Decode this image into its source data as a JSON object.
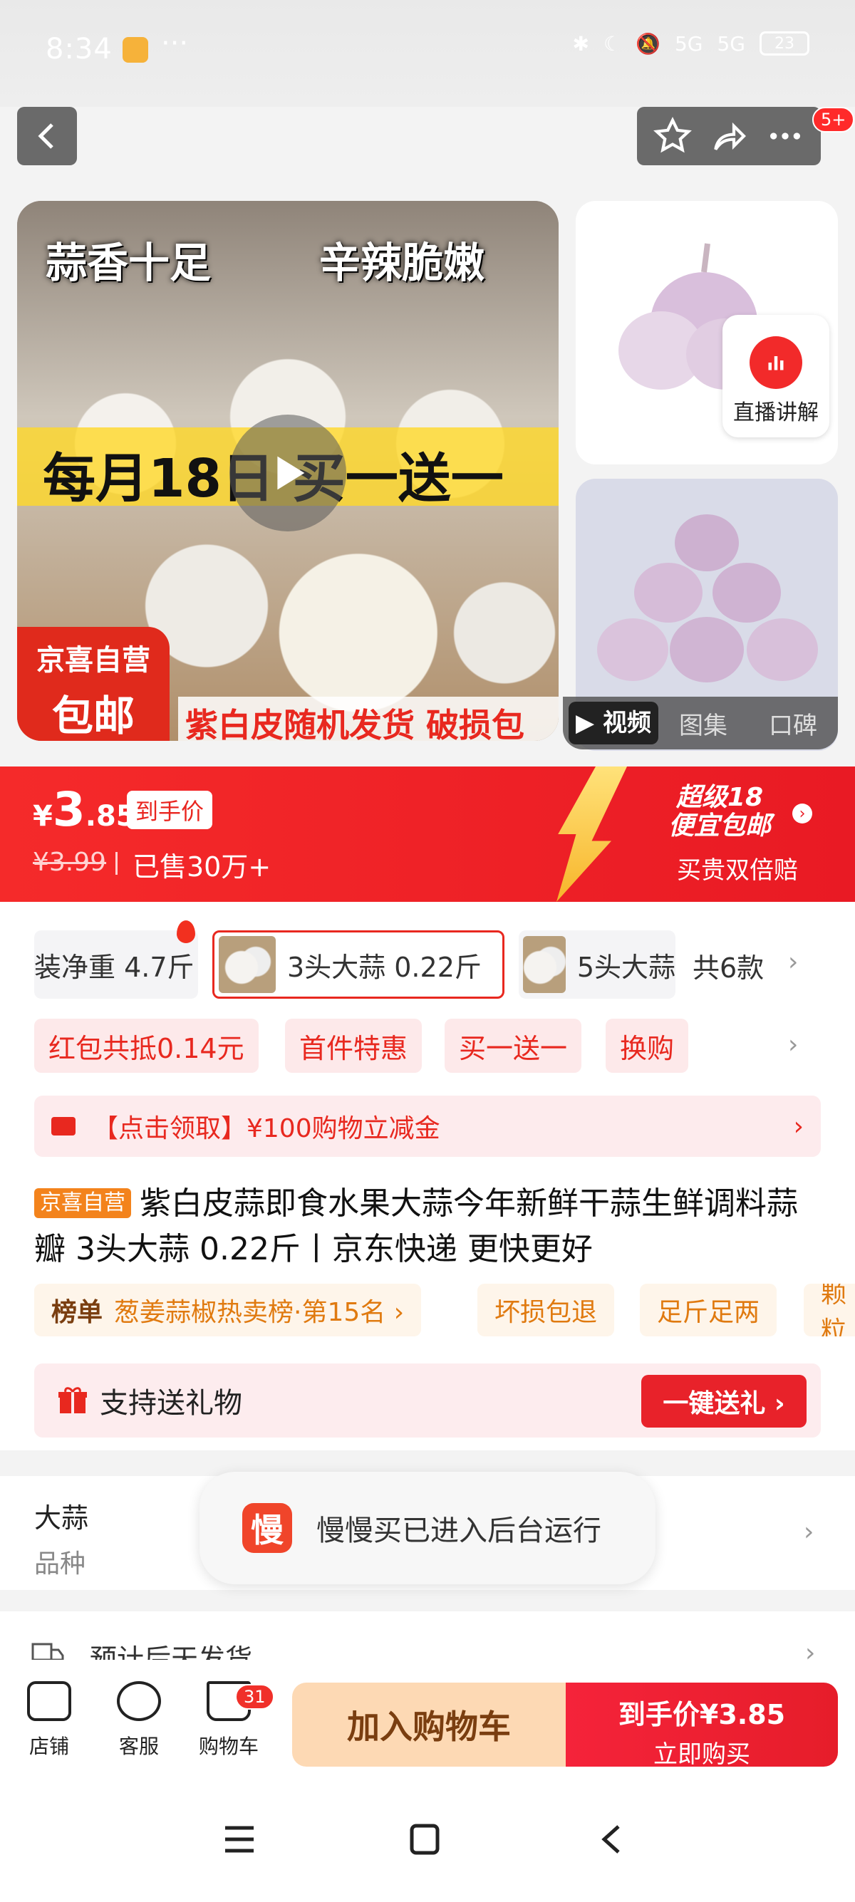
{
  "status_bar": {
    "time": "8:34",
    "dots": "···",
    "net1": "5G",
    "net2": "5G",
    "battery": "23"
  },
  "header": {
    "badge": "5+"
  },
  "gallery": {
    "main_text_left": "蒜香十足",
    "main_text_right": "辛辣脆嫩",
    "main_promo": "每月18日 买一送一",
    "corner_line1": "京喜自营",
    "corner_line2": "包邮",
    "bottom_caption": "紫白皮随机发货 破损包赔",
    "live_label": "直播讲解",
    "tabs": [
      "视频",
      "图集",
      "口碑"
    ]
  },
  "price": {
    "currency": "¥",
    "integer": "3",
    "decimal": ".85",
    "price_tag": "到手价",
    "original": "¥3.99",
    "sold": "已售30万+",
    "promo_line1": "超级18",
    "promo_line2": "便宜包邮",
    "promo_sub": "买贵双倍赔"
  },
  "variants": {
    "items": [
      "装净重 4.7斤",
      "3头大蒜 0.22斤",
      "5头大蒜"
    ],
    "total": "共6款"
  },
  "tags": [
    "红包共抵0.14元",
    "首件特惠",
    "买一送一",
    "换购"
  ],
  "coupon_banner": "【点击领取】¥100购物立减金",
  "product": {
    "store_tag": "京喜自营",
    "title": "紫白皮蒜即食水果大蒜今年新鲜干蒜生鲜调料蒜瓣 3头大蒜 0.22斤丨京东快递 更快更好"
  },
  "pills": {
    "rank_label": "榜单",
    "rank_text": "葱姜蒜椒热卖榜·第15名 ›",
    "p2": "坏损包退",
    "p3": "足斤足两",
    "p4": "颗粒"
  },
  "gift": {
    "label": "支持送礼物",
    "button": "一键送礼 ›"
  },
  "spec": {
    "value": "大蒜",
    "label": "品种"
  },
  "toast": {
    "icon": "慢",
    "text": "慢慢买已进入后台运行"
  },
  "shipping": {
    "text": "预计后天发货"
  },
  "bottom": {
    "store": "店铺",
    "service": "客服",
    "cart": "购物车",
    "cart_count": "31",
    "add_cart": "加入购物车",
    "buy_price": "到手价¥3.85",
    "buy_now": "立即购买"
  },
  "colors": {
    "brand_red": "#e8281f",
    "price_bar": "#f52a2a",
    "add_cart_bg": "#fdd9b4"
  }
}
